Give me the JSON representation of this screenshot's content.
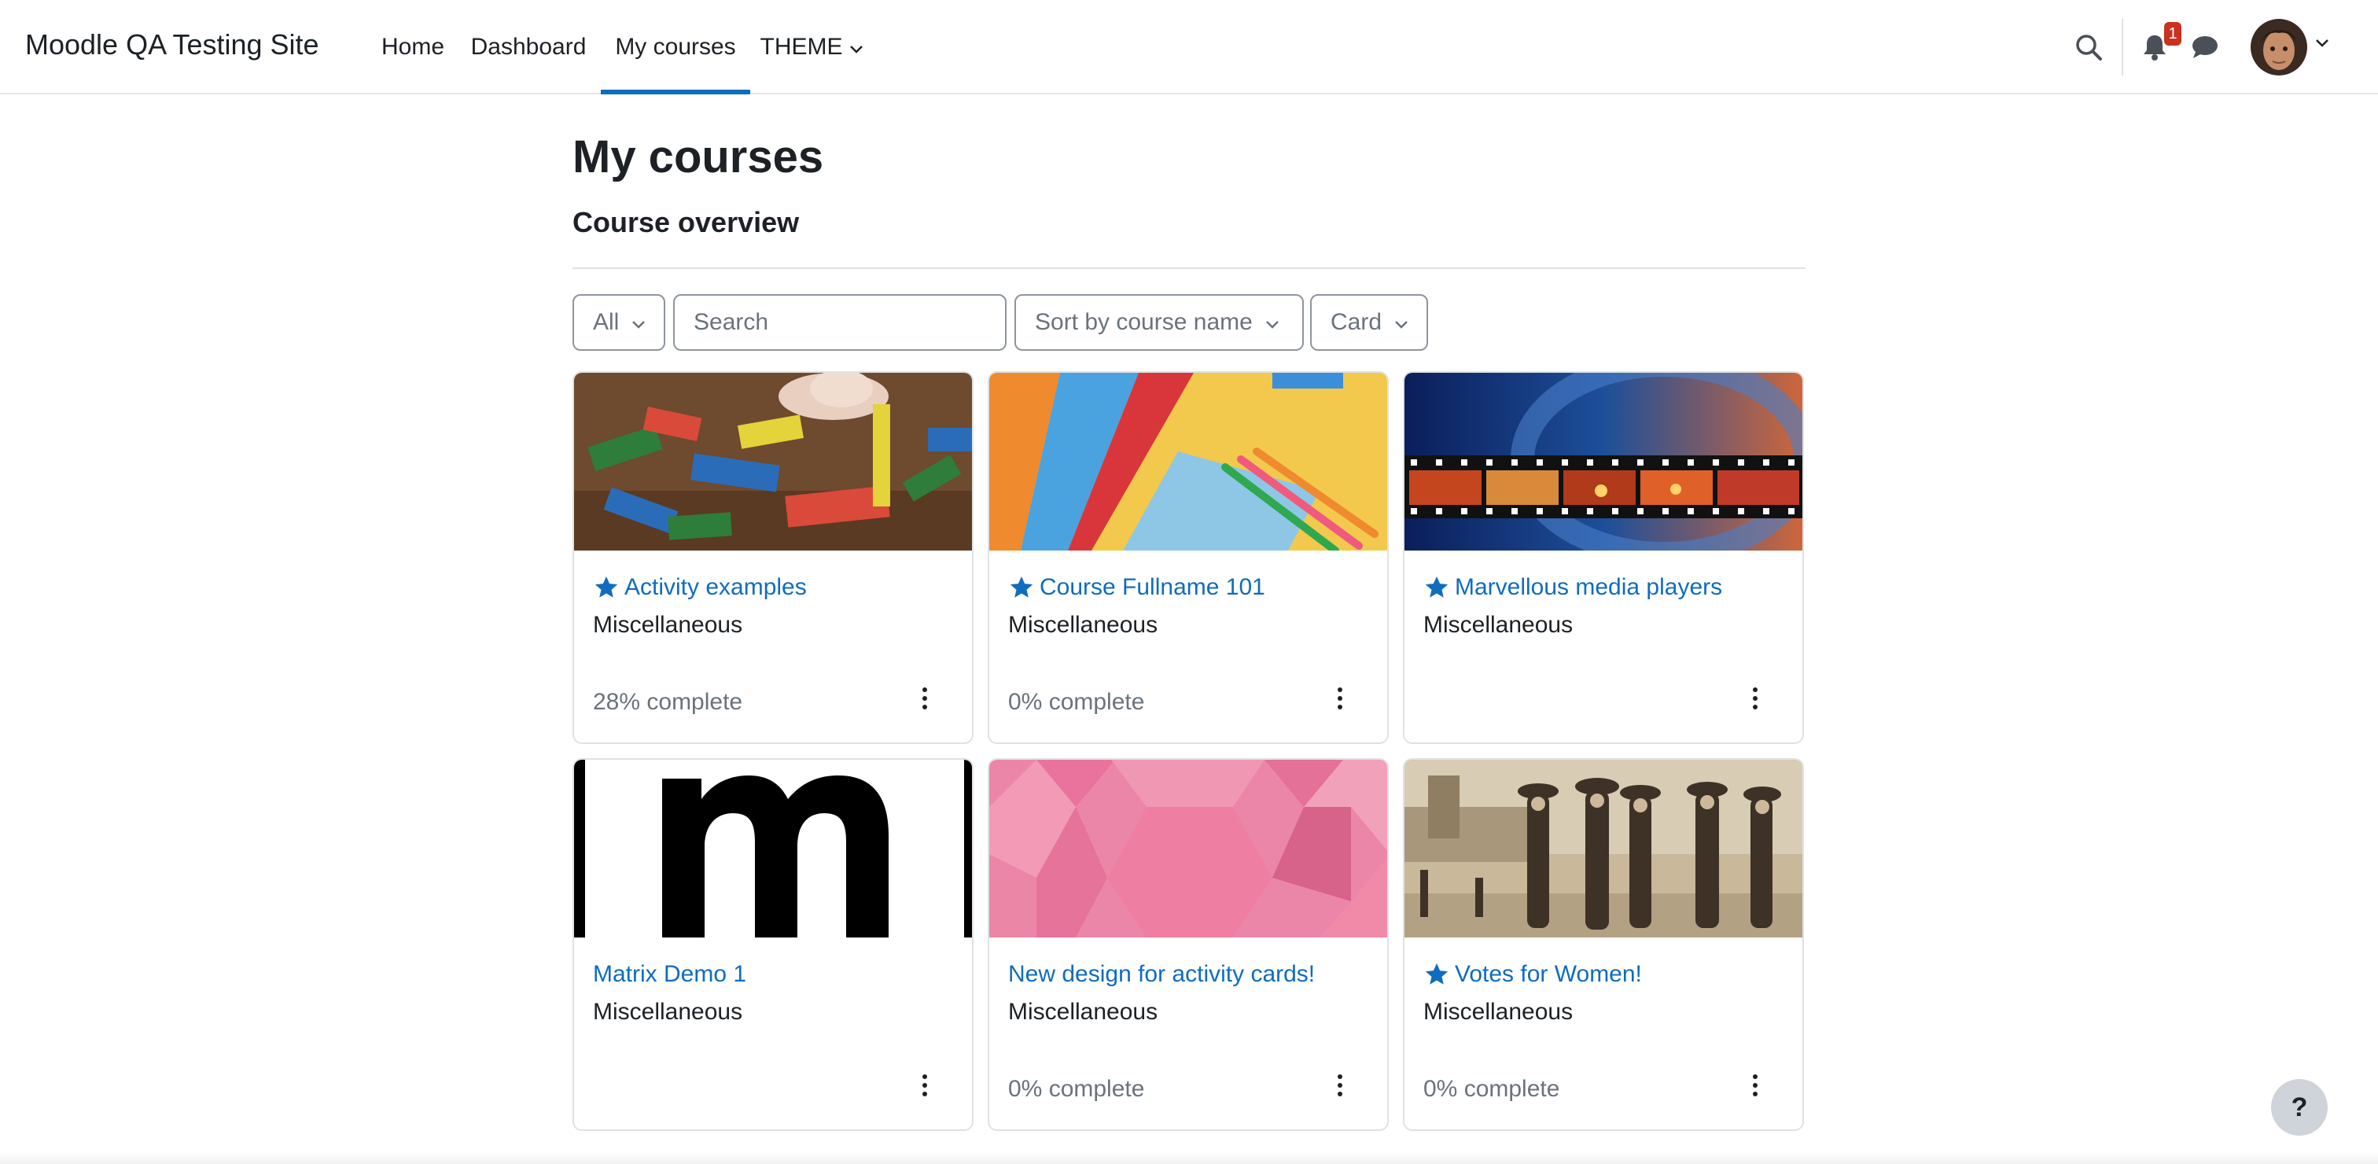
{
  "site": {
    "title": "Moodle QA Testing Site"
  },
  "nav": {
    "home": "Home",
    "dashboard": "Dashboard",
    "my_courses": "My courses",
    "theme": "THEME"
  },
  "notifications": {
    "count": "1"
  },
  "page": {
    "title": "My courses",
    "section_title": "Course overview"
  },
  "controls": {
    "filter": "All",
    "search_placeholder": "Search",
    "sort": "Sort by course name",
    "view": "Card"
  },
  "courses": [
    {
      "name": "Activity examples",
      "category": "Miscellaneous",
      "starred": true,
      "progress": "28% complete"
    },
    {
      "name": "Course Fullname 101",
      "category": "Miscellaneous",
      "starred": true,
      "progress": "0% complete"
    },
    {
      "name": "Marvellous media players",
      "category": "Miscellaneous",
      "starred": true,
      "progress": ""
    },
    {
      "name": "Matrix Demo 1",
      "category": "Miscellaneous",
      "starred": false,
      "progress": ""
    },
    {
      "name": "New design for activity cards!",
      "category": "Miscellaneous",
      "starred": false,
      "progress": "0% complete"
    },
    {
      "name": "Votes for Women!",
      "category": "Miscellaneous",
      "starred": true,
      "progress": "0% complete"
    }
  ],
  "help": {
    "label": "?"
  },
  "colors": {
    "link": "#0f6cbf",
    "active_tab": "#0f6cbf",
    "badge": "#ca3120"
  }
}
